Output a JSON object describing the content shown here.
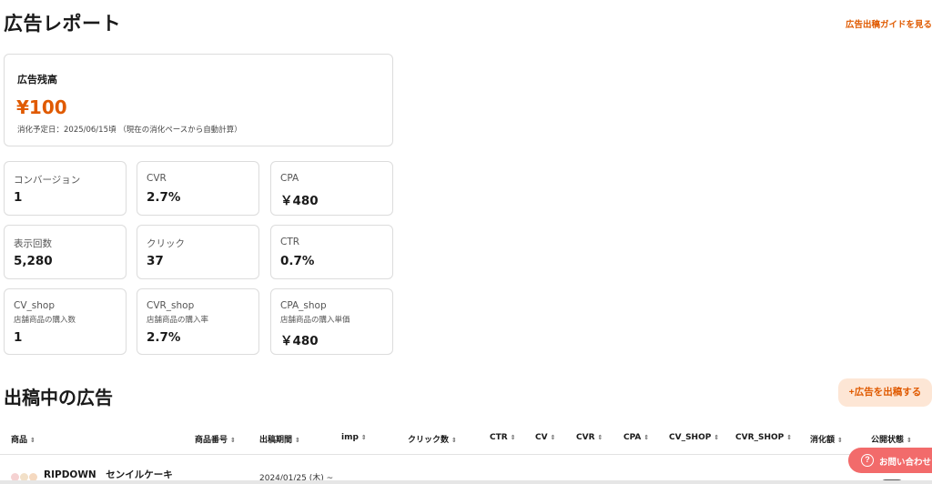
{
  "header": {
    "title": "広告レポート",
    "guide_link": "広告出稿ガイドを見る"
  },
  "balance": {
    "label": "広告残高",
    "value": "¥100",
    "note": "消化予定日：2025/06/15頃 （現在の消化ペースから自動計算）"
  },
  "metrics": [
    {
      "label": "コンバージョン",
      "value": "1"
    },
    {
      "label": "CVR",
      "value": "2.7%"
    },
    {
      "label": "CPA",
      "value": "￥480"
    },
    {
      "label": "表示回数",
      "value": "5,280"
    },
    {
      "label": "クリック",
      "value": "37"
    },
    {
      "label": "CTR",
      "value": "0.7%"
    },
    {
      "label": "CV_shop",
      "sub": "店舗商品の購入数",
      "value": "1"
    },
    {
      "label": "CVR_shop",
      "sub": "店舗商品の購入率",
      "value": "2.7%"
    },
    {
      "label": "CPA_shop",
      "sub": "店舗商品の購入単価",
      "value": "￥480"
    }
  ],
  "ads": {
    "title": "出稿中の広告",
    "add_button": "+広告を出稿する",
    "sort_glyph": "⇕",
    "columns": [
      "商品",
      "商品番号",
      "出稿期間",
      "imp",
      "クリック数",
      "CTR",
      "CV",
      "CVR",
      "CPA",
      "CV_SHOP",
      "CVR_SHOP",
      "消化額",
      "公開状態"
    ],
    "rows": [
      {
        "product": "RIPDOWN　センイルケーキ",
        "period": "2024/01/25 (木) ~"
      }
    ]
  },
  "contact": {
    "icon": "?",
    "label": "お問い合わせ"
  },
  "colors": {
    "accent": "#e05a00",
    "button_bg": "#fde6d5",
    "contact_bg": "#f26b6b"
  }
}
